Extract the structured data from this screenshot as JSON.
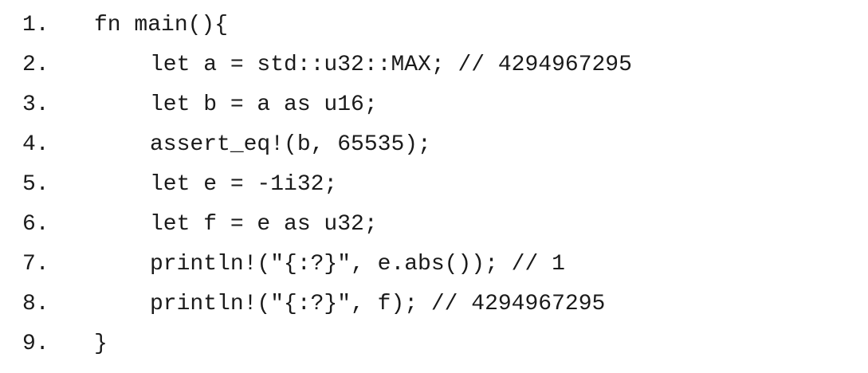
{
  "code": {
    "lines": [
      {
        "number": "1.",
        "text": "fn main(){"
      },
      {
        "number": "2.",
        "text": "let a = std::u32::MAX; // 4294967295"
      },
      {
        "number": "3.",
        "text": "let b = a as u16;"
      },
      {
        "number": "4.",
        "text": "assert_eq!(b, 65535);"
      },
      {
        "number": "5.",
        "text": "let e = -1i32;"
      },
      {
        "number": "6.",
        "text": "let f = e as u32;"
      },
      {
        "number": "7.",
        "text": "println!(\"{:?}\", e.abs()); // 1"
      },
      {
        "number": "8.",
        "text": "println!(\"{:?}\", f); // 4294967295"
      },
      {
        "number": "9.",
        "text": "}"
      }
    ]
  }
}
